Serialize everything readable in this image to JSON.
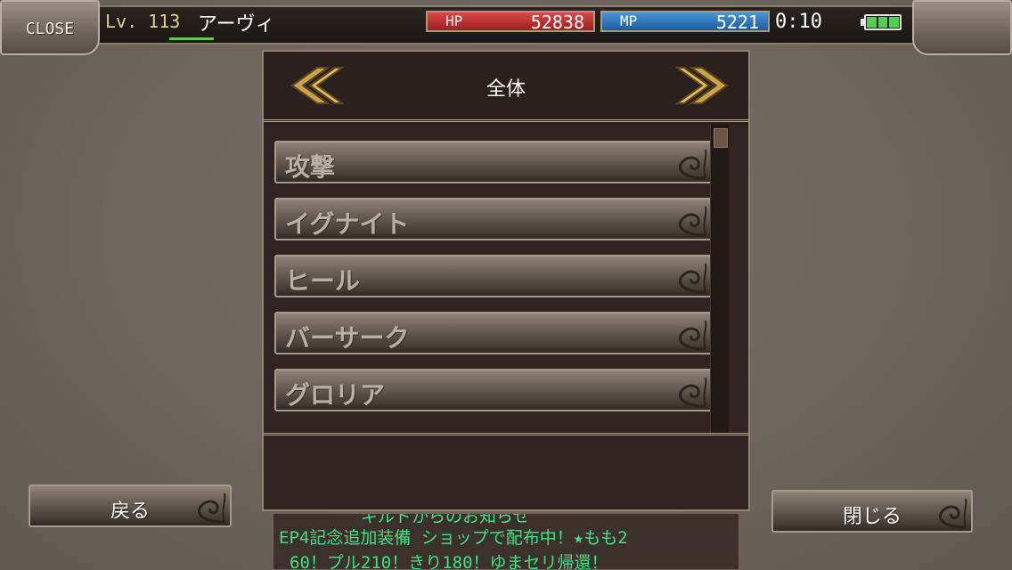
{
  "header": {
    "close_label": "CLOSE",
    "level_prefix": "Lv.",
    "level": "113",
    "character_name": "アーヴィ",
    "hp_label": "HP",
    "hp_value": "52838",
    "mp_label": "MP",
    "mp_value": "5221",
    "time": "0:10",
    "battery_icon": "battery-icon",
    "battery_level": 1.0
  },
  "panel": {
    "title": "全体",
    "prev_icon": "double-chevron-left-icon",
    "next_icon": "double-chevron-right-icon",
    "items": [
      {
        "label": "攻撃"
      },
      {
        "label": "イグナイト"
      },
      {
        "label": "ヒール"
      },
      {
        "label": "バーサーク"
      },
      {
        "label": "グロリア"
      }
    ]
  },
  "buttons": {
    "back_label": "戻る",
    "close_label": "閉じる"
  },
  "ticker": {
    "line0": "ギルドからのお知らせ",
    "line1": "EP4記念追加装備 ショップで配布中！★もも2",
    "line2": "60！プル210！きり180！ゆまセリ帰還！"
  },
  "colors": {
    "hp": "#c23434",
    "mp": "#2e78c0",
    "ticker_text": "#3fe07f",
    "level_text": "#d9d28c"
  }
}
